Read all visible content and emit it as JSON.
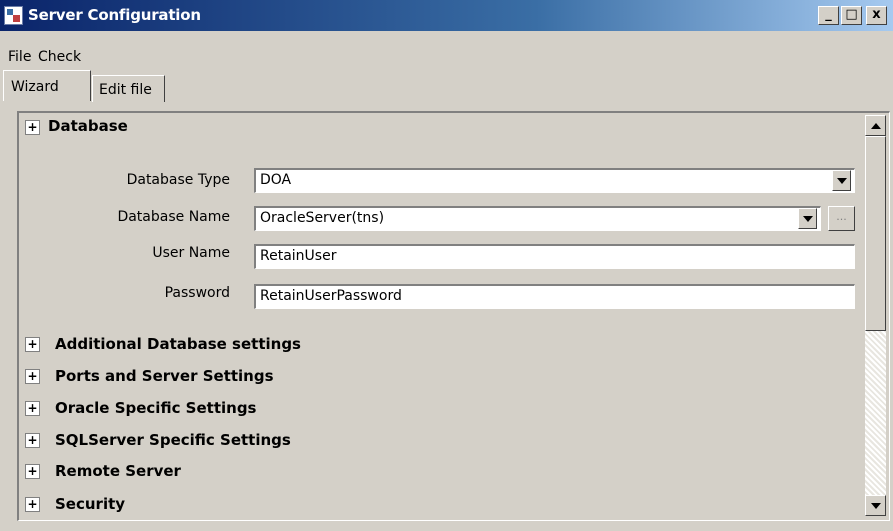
{
  "window": {
    "title": "Server Configuration",
    "minimize_glyph": "_",
    "maximize_glyph": "□",
    "close_glyph": "x"
  },
  "menu": {
    "file": "File",
    "check": "Check"
  },
  "tabs": [
    {
      "label": "Wizard",
      "selected": true
    },
    {
      "label": "Edit file",
      "selected": false
    }
  ],
  "sections": {
    "database": {
      "title": "Database",
      "expander": "+",
      "fields": {
        "database_type": {
          "label": "Database Type",
          "value": "DOA"
        },
        "database_name": {
          "label": "Database Name",
          "value": "OracleServer(tns)",
          "browse": "..."
        },
        "user_name": {
          "label": "User Name",
          "value": "RetainUser"
        },
        "password": {
          "label": "Password",
          "value": "RetainUserPassword"
        }
      }
    },
    "collapsed": [
      {
        "title": "Additional Database settings",
        "expander": "+"
      },
      {
        "title": "Ports and Server Settings",
        "expander": "+"
      },
      {
        "title": "Oracle Specific Settings",
        "expander": "+"
      },
      {
        "title": "SQLServer Specific Settings",
        "expander": "+"
      },
      {
        "title": "Remote Server",
        "expander": "+"
      },
      {
        "title": "Security",
        "expander": "+"
      }
    ]
  },
  "icons": [
    "app-icon",
    "minimize-icon",
    "maximize-icon",
    "close-icon",
    "chevron-down-icon",
    "scroll-up-icon",
    "scroll-down-icon",
    "expand-icon"
  ]
}
